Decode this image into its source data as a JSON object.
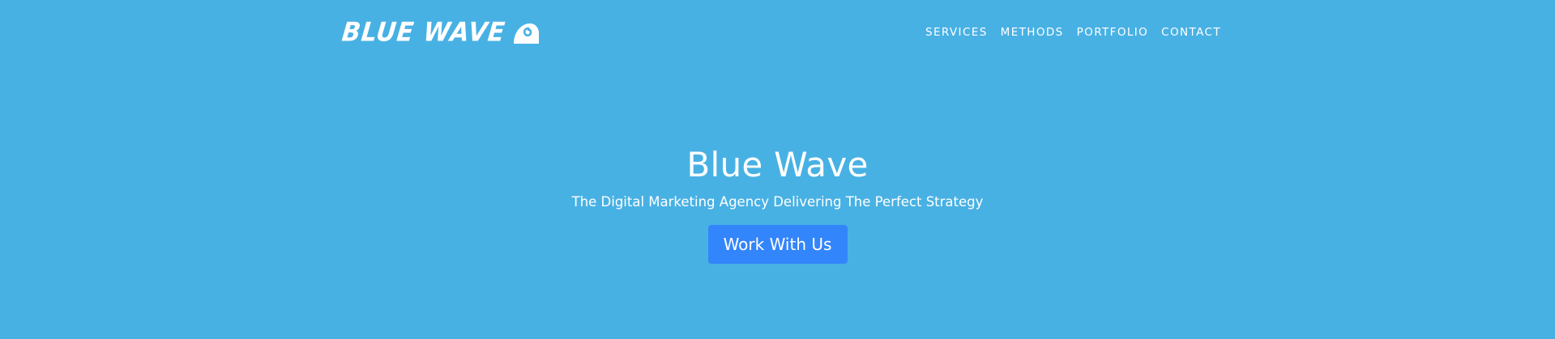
{
  "header": {
    "logo_text": "BLUE WAVE",
    "logo_icon": "wave-icon",
    "nav": [
      {
        "label": "SERVICES"
      },
      {
        "label": "METHODS"
      },
      {
        "label": "PORTFOLIO"
      },
      {
        "label": "CONTACT"
      }
    ]
  },
  "hero": {
    "title": "Blue Wave",
    "subtitle": "The Digital Marketing Agency Delivering The Perfect Strategy",
    "cta_label": "Work With Us"
  },
  "colors": {
    "background": "#48b1e4",
    "button": "#3385fb",
    "text": "#ffffff"
  }
}
